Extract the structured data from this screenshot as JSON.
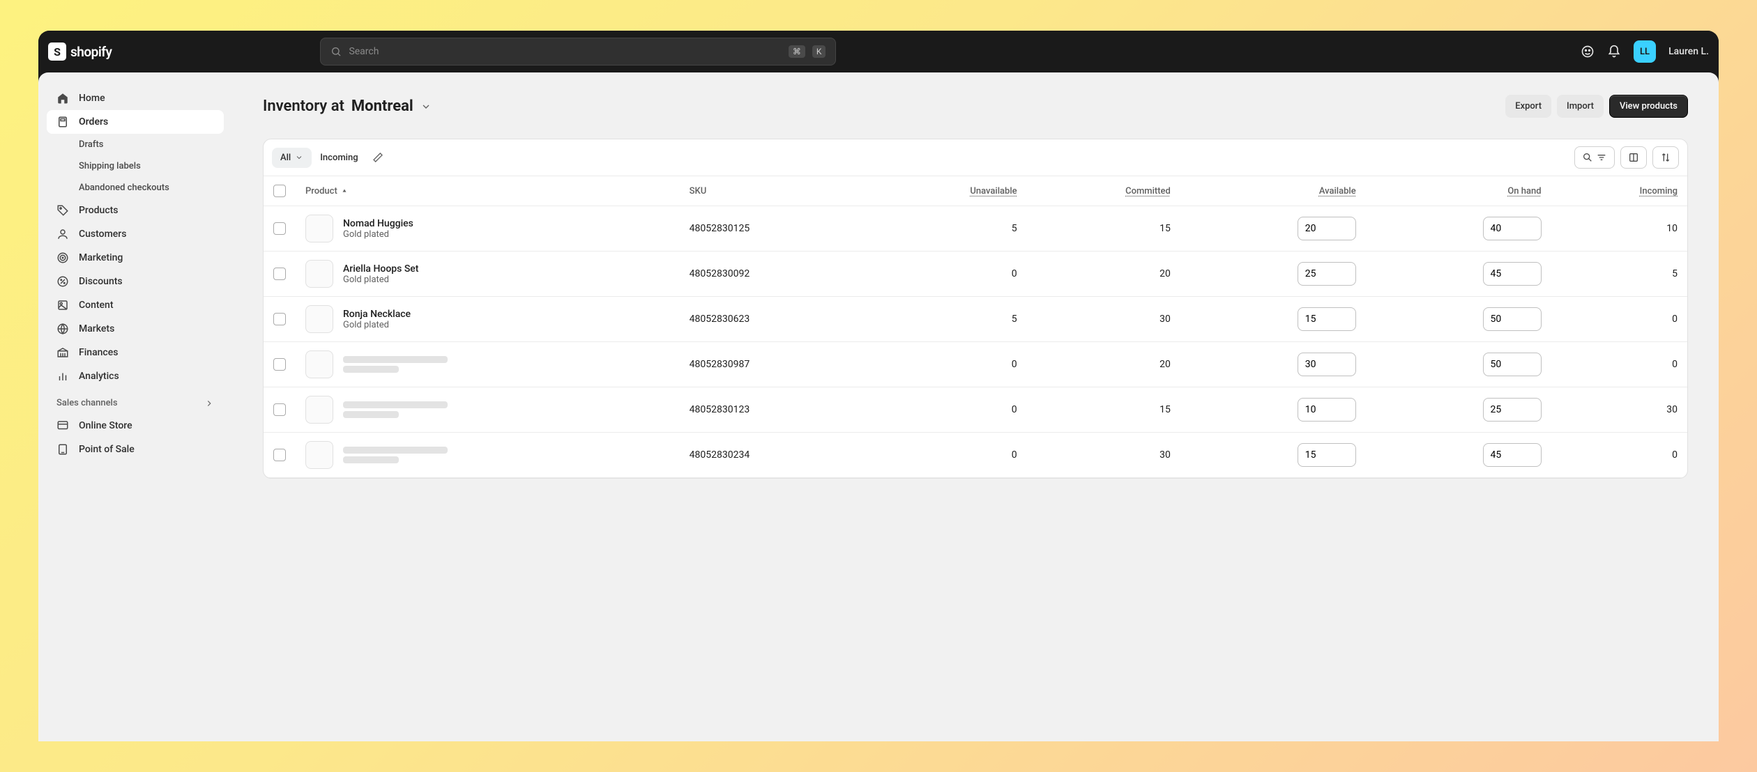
{
  "topbar": {
    "brand": "shopify",
    "search_placeholder": "Search",
    "shortcut_mod": "⌘",
    "shortcut_key": "K",
    "user_initials": "LL",
    "user_name": "Lauren L."
  },
  "sidebar": {
    "items": [
      {
        "icon": "home",
        "label": "Home"
      },
      {
        "icon": "orders",
        "label": "Orders",
        "active": true
      },
      {
        "icon": "",
        "label": "Drafts",
        "sub": true
      },
      {
        "icon": "",
        "label": "Shipping labels",
        "sub": true
      },
      {
        "icon": "",
        "label": "Abandoned checkouts",
        "sub": true
      },
      {
        "icon": "products",
        "label": "Products"
      },
      {
        "icon": "customers",
        "label": "Customers"
      },
      {
        "icon": "marketing",
        "label": "Marketing"
      },
      {
        "icon": "discounts",
        "label": "Discounts"
      },
      {
        "icon": "content",
        "label": "Content"
      },
      {
        "icon": "markets",
        "label": "Markets"
      },
      {
        "icon": "finances",
        "label": "Finances"
      },
      {
        "icon": "analytics",
        "label": "Analytics"
      }
    ],
    "section_label": "Sales channels",
    "channels": [
      {
        "icon": "online-store",
        "label": "Online Store"
      },
      {
        "icon": "pos",
        "label": "Point of Sale"
      }
    ]
  },
  "page": {
    "title_prefix": "Inventory at",
    "location": "Montreal",
    "buttons": {
      "export": "Export",
      "import": "Import",
      "view": "View products"
    }
  },
  "tabs": {
    "all": "All",
    "incoming": "Incoming"
  },
  "columns": {
    "product": "Product",
    "sku": "SKU",
    "unavailable": "Unavailable",
    "committed": "Committed",
    "available": "Available",
    "on_hand": "On hand",
    "incoming": "Incoming"
  },
  "rows": [
    {
      "name": "Nomad Huggies",
      "variant": "Gold plated",
      "sku": "48052830125",
      "unavailable": "5",
      "committed": "15",
      "available": "20",
      "on_hand": "40",
      "incoming": "10",
      "skeleton": false
    },
    {
      "name": "Ariella Hoops Set",
      "variant": "Gold plated",
      "sku": "48052830092",
      "unavailable": "0",
      "committed": "20",
      "available": "25",
      "on_hand": "45",
      "incoming": "5",
      "skeleton": false
    },
    {
      "name": "Ronja Necklace",
      "variant": "Gold plated",
      "sku": "48052830623",
      "unavailable": "5",
      "committed": "30",
      "available": "15",
      "on_hand": "50",
      "incoming": "0",
      "skeleton": false
    },
    {
      "name": "",
      "variant": "",
      "sku": "48052830987",
      "unavailable": "0",
      "committed": "20",
      "available": "30",
      "on_hand": "50",
      "incoming": "0",
      "skeleton": true
    },
    {
      "name": "",
      "variant": "",
      "sku": "48052830123",
      "unavailable": "0",
      "committed": "15",
      "available": "10",
      "on_hand": "25",
      "incoming": "30",
      "skeleton": true
    },
    {
      "name": "",
      "variant": "",
      "sku": "48052830234",
      "unavailable": "0",
      "committed": "30",
      "available": "15",
      "on_hand": "45",
      "incoming": "0",
      "skeleton": true
    }
  ]
}
